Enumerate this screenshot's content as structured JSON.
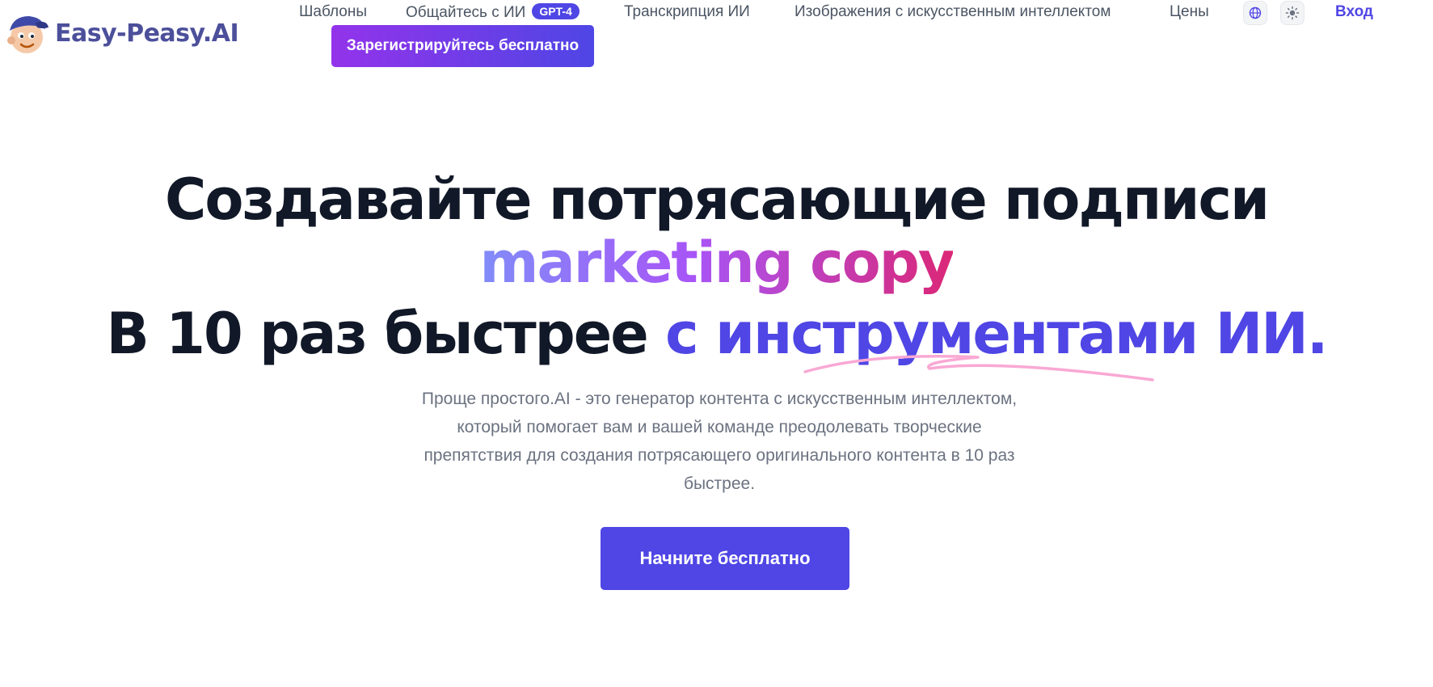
{
  "header": {
    "logo_text": "Easy-Peasy.AI",
    "nav": {
      "templates": "Шаблоны",
      "chat": "Общайтесь с ИИ",
      "chat_badge": "GPT-4",
      "transcription": "Транскрипция ИИ",
      "images": "Изображения с искусственным интеллектом",
      "pricing": "Цены"
    },
    "icons": {
      "language": "globe-icon",
      "theme": "sun-icon"
    },
    "login_label": "Вход",
    "signup_label": "Зарегистрируйтесь бесплатно"
  },
  "hero": {
    "line1": "Создавайте потрясающие подписи",
    "line2": "marketing copy",
    "line3_dark": "В 10 раз быстрее",
    "line3_accent": "с инструментами ИИ.",
    "description": "Проще простого.AI - это генератор контента с искусственным интеллектом, который помогает вам и вашей команде преодолевать творческие препятствия для создания потрясающего оригинального контента в 10 раз быстрее.",
    "cta_label": "Начните бесплатно"
  },
  "colors": {
    "accent": "#4f46e5",
    "gradient_start": "#818cf8",
    "gradient_end": "#db2777",
    "text_dark": "#111827",
    "text_muted": "#6b7280"
  }
}
